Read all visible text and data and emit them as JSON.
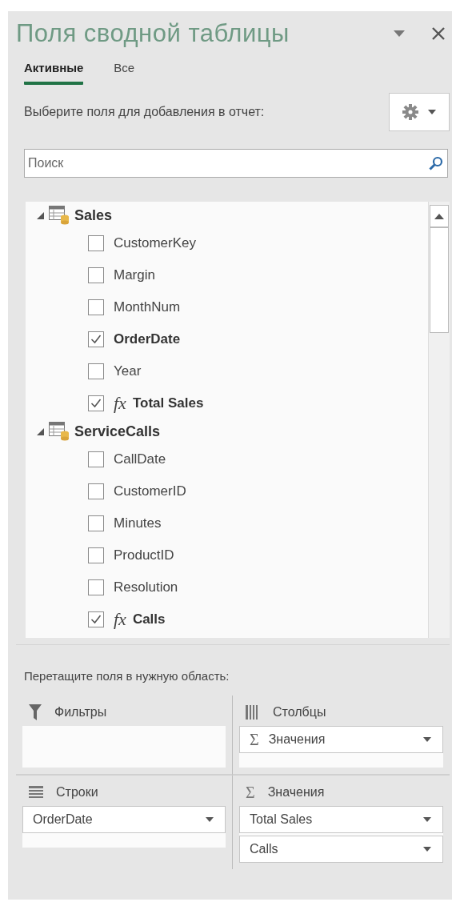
{
  "title": "Поля сводной таблицы",
  "tabs": [
    {
      "label": "Активные",
      "selected": true
    },
    {
      "label": "Все",
      "selected": false
    }
  ],
  "choose_label": "Выберите поля для добавления в отчет:",
  "search": {
    "placeholder": "Поиск"
  },
  "tables": [
    {
      "name": "Sales",
      "expanded": true,
      "fields": [
        {
          "name": "CustomerKey",
          "checked": false,
          "kind": "column"
        },
        {
          "name": "Margin",
          "checked": false,
          "kind": "column"
        },
        {
          "name": "MonthNum",
          "checked": false,
          "kind": "column"
        },
        {
          "name": "OrderDate",
          "checked": true,
          "kind": "column"
        },
        {
          "name": "Year",
          "checked": false,
          "kind": "column"
        },
        {
          "name": "Total Sales",
          "checked": true,
          "kind": "measure",
          "prefix": "fx"
        }
      ]
    },
    {
      "name": "ServiceCalls",
      "expanded": true,
      "fields": [
        {
          "name": "CallDate",
          "checked": false,
          "kind": "column"
        },
        {
          "name": "CustomerID",
          "checked": false,
          "kind": "column"
        },
        {
          "name": "Minutes",
          "checked": false,
          "kind": "column"
        },
        {
          "name": "ProductID",
          "checked": false,
          "kind": "column"
        },
        {
          "name": "Resolution",
          "checked": false,
          "kind": "column"
        },
        {
          "name": "Calls",
          "checked": true,
          "kind": "measure",
          "prefix": "fx"
        }
      ]
    }
  ],
  "drag_label": "Перетащите поля в нужную область:",
  "areas": [
    {
      "kind": "filters",
      "title": "Фильтры"
    },
    {
      "kind": "columns",
      "title": "Столбцы",
      "items": [
        {
          "label": "Значения",
          "prefix": "Σ"
        }
      ]
    },
    {
      "kind": "rows",
      "title": "Строки",
      "items": [
        {
          "label": "OrderDate"
        }
      ]
    },
    {
      "kind": "values",
      "symbol": "Σ",
      "title": "Значения",
      "items": [
        {
          "label": "Total Sales"
        },
        {
          "label": "Calls"
        }
      ]
    }
  ]
}
